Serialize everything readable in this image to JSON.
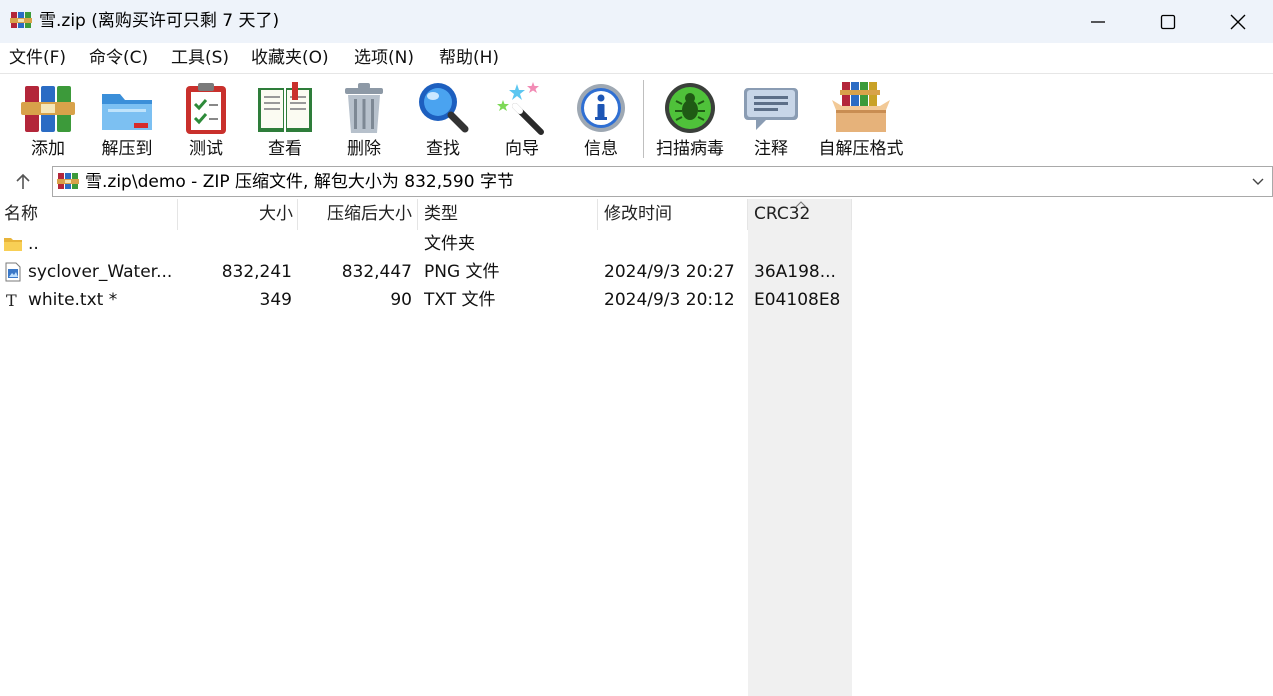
{
  "window": {
    "title": "雪.zip (离购买许可只剩 7 天了)",
    "controls": [
      "minimize",
      "maximize",
      "close"
    ]
  },
  "menu": [
    {
      "label": "文件(F)"
    },
    {
      "label": "命令(C)"
    },
    {
      "label": "工具(S)"
    },
    {
      "label": "收藏夹(O)"
    },
    {
      "label": "选项(N)"
    },
    {
      "label": "帮助(H)"
    }
  ],
  "toolbar": [
    {
      "label": "添加",
      "icon": "books-add-icon"
    },
    {
      "label": "解压到",
      "icon": "folder-extract-icon"
    },
    {
      "label": "测试",
      "icon": "clipboard-test-icon"
    },
    {
      "label": "查看",
      "icon": "book-view-icon"
    },
    {
      "label": "删除",
      "icon": "trash-icon"
    },
    {
      "label": "查找",
      "icon": "magnifier-icon"
    },
    {
      "label": "向导",
      "icon": "magic-wand-icon"
    },
    {
      "label": "信息",
      "icon": "info-icon"
    },
    {
      "label": "扫描病毒",
      "icon": "virus-scan-icon"
    },
    {
      "label": "注释",
      "icon": "comment-icon"
    },
    {
      "label": "自解压格式",
      "icon": "sfx-box-icon"
    }
  ],
  "address": {
    "text": "雪.zip\\demo - ZIP 压缩文件, 解包大小为 832,590 字节"
  },
  "columns": [
    {
      "label": "名称"
    },
    {
      "label": "大小"
    },
    {
      "label": "压缩后大小"
    },
    {
      "label": "类型"
    },
    {
      "label": "修改时间"
    },
    {
      "label": "CRC32",
      "sorted": true
    }
  ],
  "rows": [
    {
      "icon": "folder-icon",
      "name": "..",
      "size": "",
      "packed": "",
      "type": "文件夹",
      "modified": "",
      "crc": ""
    },
    {
      "icon": "png-file-icon",
      "name": "syclover_Water...",
      "size": "832,241",
      "packed": "832,447",
      "type": "PNG 文件",
      "modified": "2024/9/3 20:27",
      "crc": "36A198..."
    },
    {
      "icon": "txt-file-icon",
      "name": "white.txt *",
      "size": "349",
      "packed": "90",
      "type": "TXT 文件",
      "modified": "2024/9/3 20:12",
      "crc": "E04108E8"
    }
  ],
  "colors": {
    "titlebar_bg": "#eef3fa",
    "sorted_column_bg": "#f0f0f0"
  }
}
